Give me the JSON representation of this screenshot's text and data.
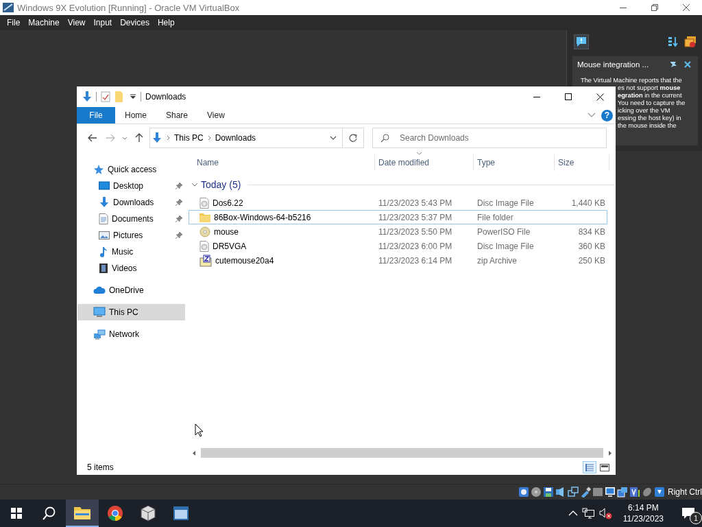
{
  "vm_window": {
    "title": "Windows 9X Evolution [Running] - Oracle VM VirtualBox",
    "menu": [
      "File",
      "Machine",
      "View",
      "Input",
      "Devices",
      "Help"
    ]
  },
  "notification": {
    "title": "Mouse integration ...",
    "lines": [
      "The Virtual Machine reports that the",
      "es not support **mouse**",
      "**egration** in the current",
      "You need to capture the",
      "icking over the VM",
      "essing the host key) in",
      "the mouse inside the"
    ]
  },
  "explorer": {
    "title": "Downloads",
    "ribbon_tabs": [
      {
        "label": "File",
        "selected": true
      },
      {
        "label": "Home",
        "selected": false
      },
      {
        "label": "Share",
        "selected": false
      },
      {
        "label": "View",
        "selected": false
      }
    ],
    "help_label": "?",
    "address": {
      "path": [
        "This PC",
        "Downloads"
      ]
    },
    "search": {
      "placeholder": "Search Downloads"
    },
    "navigation": [
      {
        "label": "Quick access",
        "kind": "star",
        "selected": false,
        "children": [
          {
            "label": "Desktop",
            "kind": "desktop",
            "pinned": true,
            "selected": false
          },
          {
            "label": "Downloads",
            "kind": "download",
            "pinned": true,
            "selected": false
          },
          {
            "label": "Documents",
            "kind": "document",
            "pinned": true,
            "selected": false
          },
          {
            "label": "Pictures",
            "kind": "pictures",
            "pinned": true,
            "selected": false
          },
          {
            "label": "Music",
            "kind": "music",
            "pinned": false,
            "selected": false
          },
          {
            "label": "Videos",
            "kind": "videos",
            "pinned": false,
            "selected": false
          }
        ]
      },
      {
        "label": "OneDrive",
        "kind": "cloud",
        "selected": false
      },
      {
        "label": "This PC",
        "kind": "pc",
        "selected": true
      },
      {
        "label": "Network",
        "kind": "network",
        "selected": false
      }
    ],
    "columns": [
      {
        "label": "Name",
        "sorted": false
      },
      {
        "label": "Date modified",
        "sorted": true
      },
      {
        "label": "Type",
        "sorted": false
      },
      {
        "label": "Size",
        "sorted": false
      }
    ],
    "groups": [
      {
        "label": "Today (5)",
        "expanded": true,
        "rows": [
          {
            "name": "Dos6.22",
            "kind": "disc-image",
            "date": "11/23/2023 5:43 PM",
            "type": "Disc Image File",
            "size": "1,440 KB",
            "focused": false
          },
          {
            "name": "86Box-Windows-64-b5216",
            "kind": "folder",
            "date": "11/23/2023 5:37 PM",
            "type": "File folder",
            "focused": true
          },
          {
            "name": "mouse",
            "kind": "cd",
            "date": "11/23/2023 5:50 PM",
            "type": "PowerISO File",
            "size": "834 KB",
            "focused": false
          },
          {
            "name": "DR5VGA",
            "kind": "disc-image",
            "date": "11/23/2023 6:00 PM",
            "type": "Disc Image File",
            "size": "360 KB",
            "focused": false
          },
          {
            "name": "cutemouse20a4",
            "kind": "archive",
            "date": "11/23/2023 6:14 PM",
            "type": "zip Archive",
            "size": "250 KB",
            "focused": false
          }
        ]
      }
    ],
    "status": "5 items",
    "view_modes": [
      {
        "kind": "details",
        "selected": true
      },
      {
        "kind": "tiles",
        "selected": false
      }
    ]
  },
  "status_bar": {
    "host_key": "Right Ctrl"
  },
  "taskbar": {
    "apps": [
      {
        "kind": "explorer",
        "active": true
      },
      {
        "kind": "browser",
        "active": false
      },
      {
        "kind": "cube",
        "active": false
      },
      {
        "kind": "app",
        "active": false
      }
    ],
    "time": "6:14 PM",
    "date": "11/23/2023",
    "notification_count": "1"
  }
}
